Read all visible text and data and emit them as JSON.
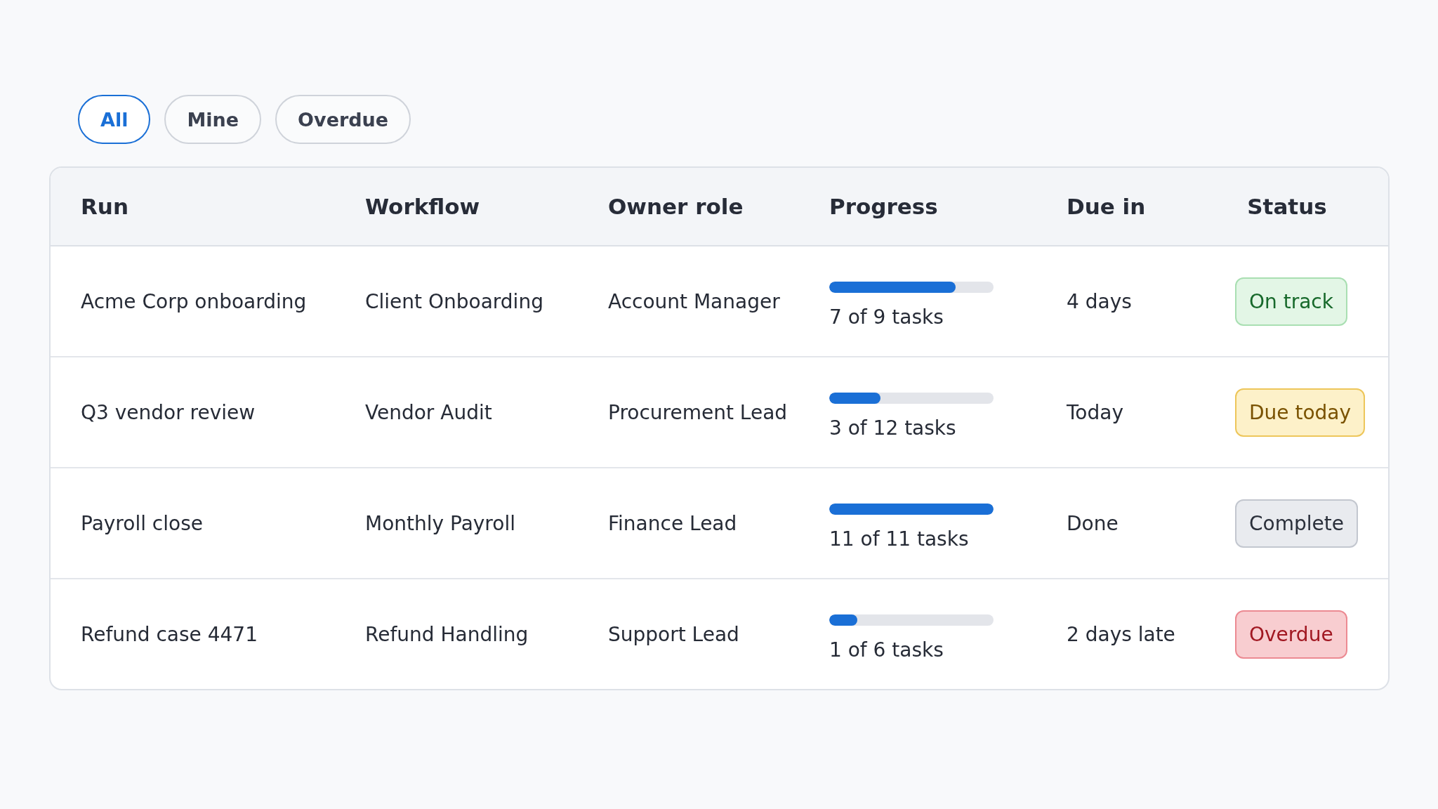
{
  "filters": [
    {
      "label": "All",
      "selected": true
    },
    {
      "label": "Mine",
      "selected": false
    },
    {
      "label": "Overdue",
      "selected": false
    }
  ],
  "table": {
    "columns": [
      "Run",
      "Workflow",
      "Owner role",
      "Progress",
      "Due in",
      "Status"
    ],
    "rows": [
      {
        "run": "Acme Corp onboarding",
        "workflow": "Client Onboarding",
        "owner_role": "Account Manager",
        "progress": {
          "level": 0.77,
          "label": "7 of 9 tasks"
        },
        "due_in": "4 days",
        "status": {
          "label": "On track",
          "kind": "on_track"
        }
      },
      {
        "run": "Q3 vendor review",
        "workflow": "Vendor Audit",
        "owner_role": "Procurement Lead",
        "progress": {
          "level": 0.31,
          "label": "3 of 12 tasks"
        },
        "due_in": "Today",
        "status": {
          "label": "Due today",
          "kind": "due_today"
        }
      },
      {
        "run": "Payroll close",
        "workflow": "Monthly Payroll",
        "owner_role": "Finance Lead",
        "progress": {
          "level": 1,
          "label": "11 of 11 tasks"
        },
        "due_in": "Done",
        "status": {
          "label": "Complete",
          "kind": "complete"
        }
      },
      {
        "run": "Refund case 4471",
        "workflow": "Refund Handling",
        "owner_role": "Support Lead",
        "progress": {
          "level": 0.17,
          "label": "1 of 6 tasks"
        },
        "due_in": "2 days late",
        "status": {
          "label": "Overdue",
          "kind": "overdue"
        }
      }
    ]
  }
}
